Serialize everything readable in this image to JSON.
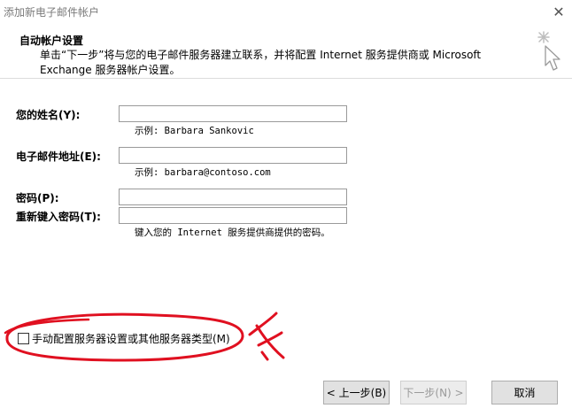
{
  "window": {
    "title": "添加新电子邮件帐户"
  },
  "header": {
    "title": "自动帐户设置",
    "description": "单击“下一步”将与您的电子邮件服务器建立联系，并将配置 Internet 服务提供商或 Microsoft Exchange 服务器帐户设置。"
  },
  "form": {
    "name": {
      "label": "您的姓名(Y):",
      "value": "",
      "hint": "示例: Barbara Sankovic"
    },
    "email": {
      "label": "电子邮件地址(E):",
      "value": "",
      "hint": "示例: barbara@contoso.com"
    },
    "password": {
      "label": "密码(P):",
      "value": ""
    },
    "retype_password": {
      "label": "重新键入密码(T):",
      "value": "",
      "hint": "键入您的 Internet 服务提供商提供的密码。"
    }
  },
  "manual_setup": {
    "label": "手动配置服务器设置或其他服务器类型(M)",
    "checked": false
  },
  "buttons": {
    "back": "< 上一步(B)",
    "next": "下一步(N) >",
    "cancel": "取消"
  },
  "colors": {
    "annotation": "#e01020"
  },
  "icons": [
    "close-icon",
    "wizard-cursor-icon"
  ]
}
